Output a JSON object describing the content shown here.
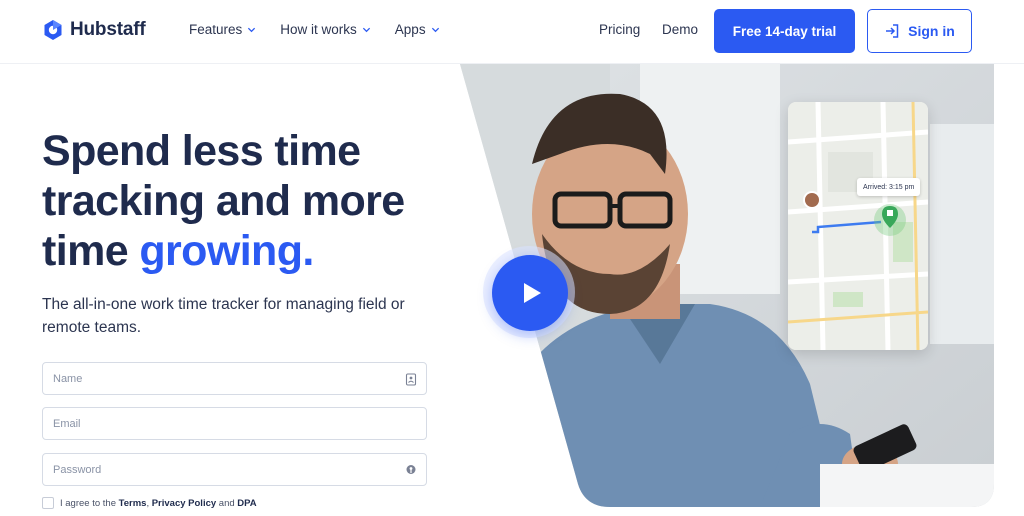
{
  "brand": {
    "name": "Hubstaff",
    "accent": "#2b5af2"
  },
  "nav": {
    "items": [
      {
        "label": "Features"
      },
      {
        "label": "How it works"
      },
      {
        "label": "Apps"
      }
    ],
    "pricing": "Pricing",
    "demo": "Demo",
    "trial_button": "Free 14-day trial",
    "signin_button": "Sign in"
  },
  "hero": {
    "headline_line1": "Spend less time",
    "headline_line2": "tracking and more",
    "headline_line3_plain": "time ",
    "headline_line3_accent": "growing.",
    "subtitle": "The all-in-one work time tracker for managing field or remote teams."
  },
  "form": {
    "name_placeholder": "Name",
    "email_placeholder": "Email",
    "password_placeholder": "Password",
    "agree_prefix": "I agree to the ",
    "terms": "Terms",
    "sep1": ", ",
    "privacy": "Privacy Policy",
    "sep2": " and ",
    "dpa": "DPA"
  },
  "map": {
    "arrived_label": "Arrived: 3:15 pm"
  },
  "icons": [
    "logo-icon",
    "chevron-down-icon",
    "sign-in-icon",
    "contact-card-icon",
    "key-icon",
    "play-icon",
    "location-pin-icon"
  ]
}
